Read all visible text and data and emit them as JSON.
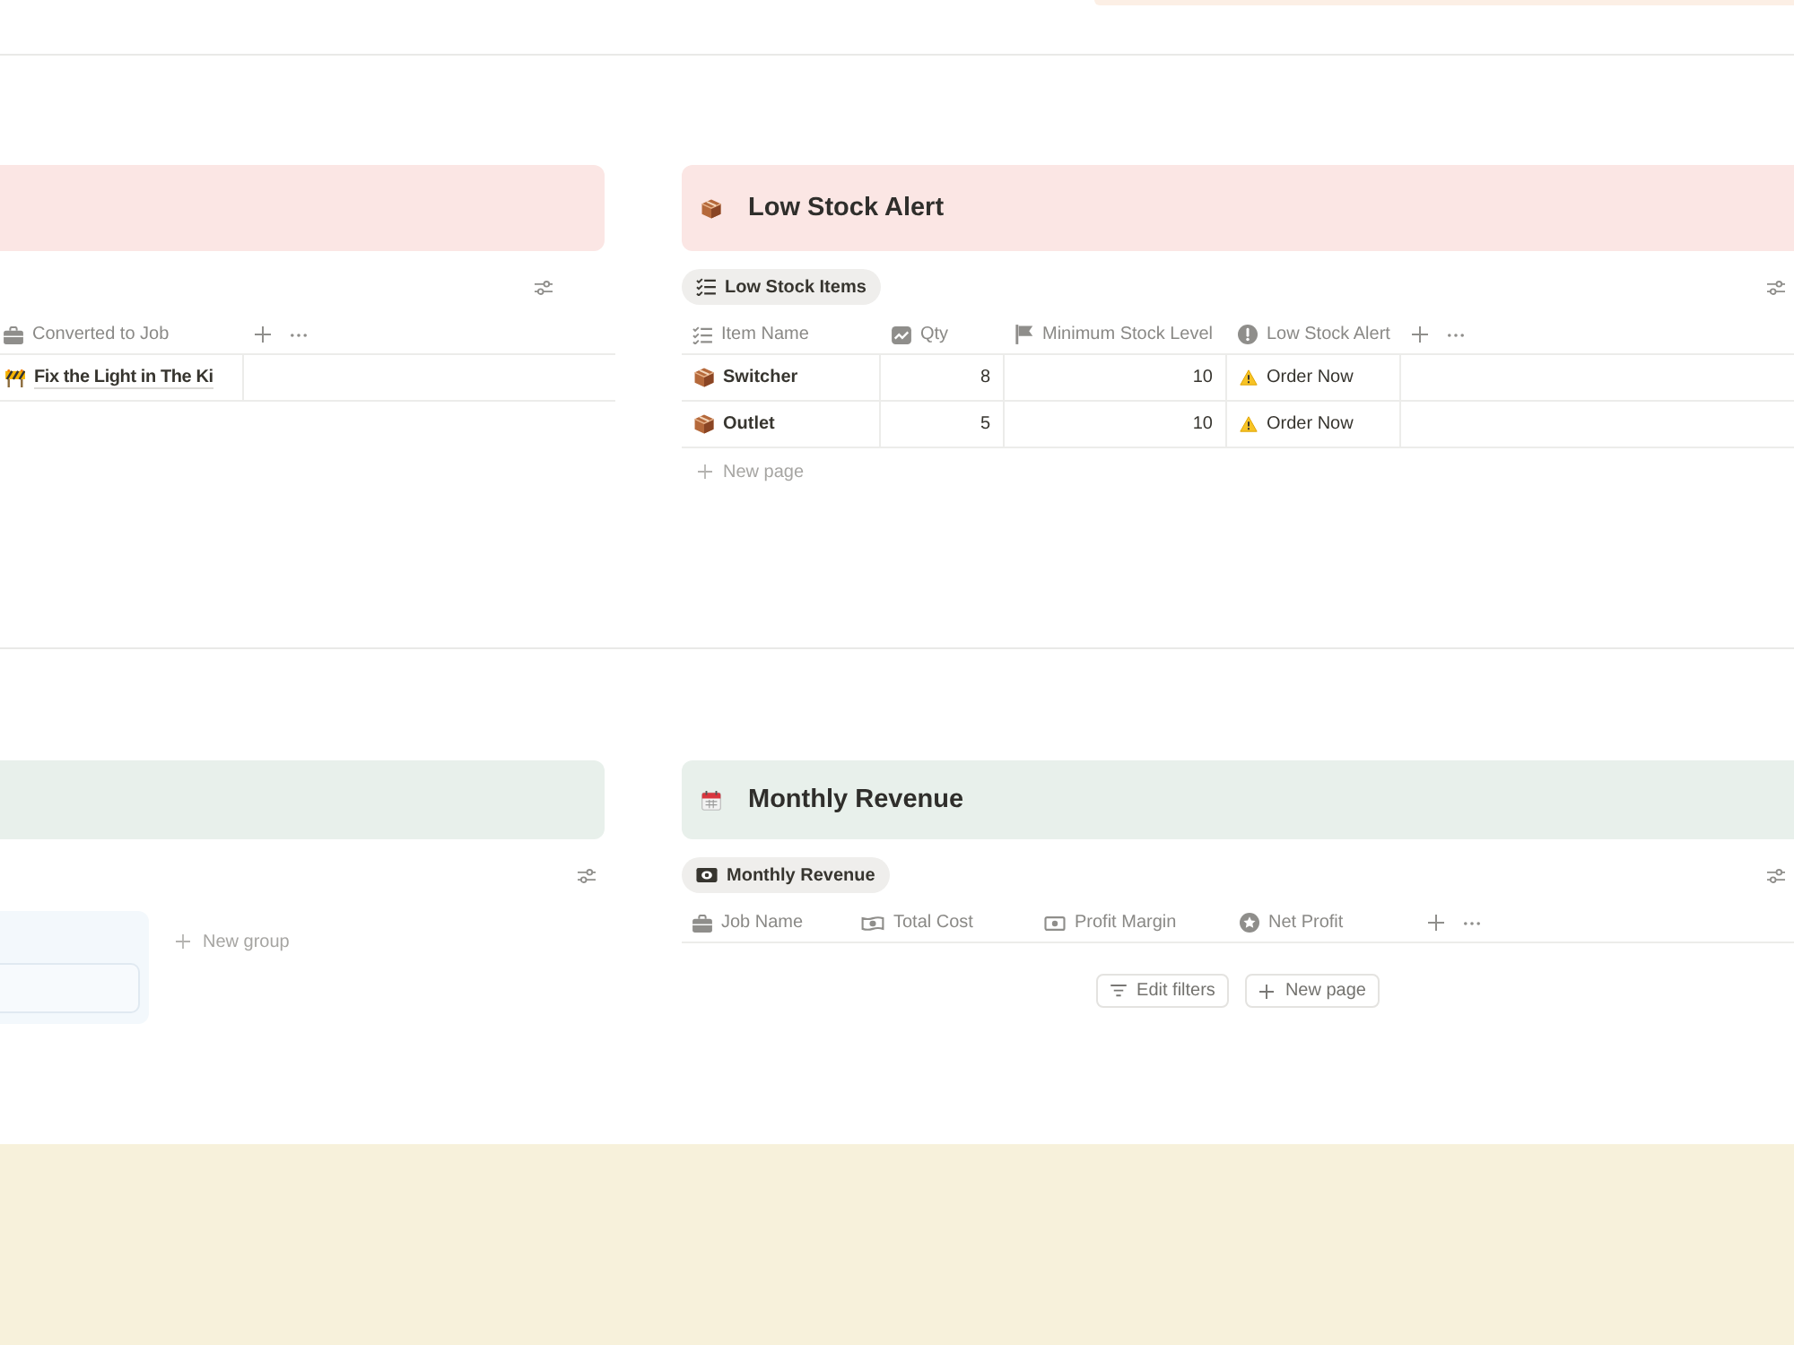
{
  "blocks": [
    {
      "kind": "callout",
      "color": "#fcefe5"
    },
    {
      "kind": "divider"
    },
    {
      "kind": "columns",
      "sections": [
        {
          "banner": {
            "color": "#fbe6e4"
          },
          "view": {
            "kind": "table",
            "columns": [
              {
                "label": "Converted to Job",
                "kind": "relation"
              }
            ],
            "rows": [
              {
                "cells": [
                  "Fix the Light in The Ki"
                ]
              }
            ]
          }
        },
        {
          "banner": {
            "color": "#fbe6e4",
            "title": "Low Stock Alert"
          },
          "view": {
            "kind": "table",
            "tabs": [
              {
                "label": "Low Stock Items",
                "selected": true
              }
            ],
            "columns": [
              {
                "label": "Item Name",
                "kind": "title"
              },
              {
                "label": "Qty",
                "kind": "number"
              },
              {
                "label": "Minimum Stock Level",
                "kind": "number"
              },
              {
                "label": "Low Stock Alert",
                "kind": "alert"
              }
            ],
            "rows": [
              {
                "cells": [
                  "Switcher",
                  "8",
                  "10",
                  "Order Now"
                ]
              },
              {
                "cells": [
                  "Outlet",
                  "5",
                  "10",
                  "Order Now"
                ]
              }
            ],
            "new_page": "New page"
          }
        }
      ]
    },
    {
      "kind": "divider"
    },
    {
      "kind": "columns",
      "sections": [
        {
          "banner": {
            "color": "#e8f0eb"
          },
          "view": {
            "kind": "board",
            "new_group": "New group"
          }
        },
        {
          "banner": {
            "color": "#e8f0eb",
            "title": "Monthly Revenue"
          },
          "view": {
            "kind": "table",
            "tabs": [
              {
                "label": "Monthly Revenue",
                "selected": true
              }
            ],
            "columns": [
              {
                "label": "Job Name"
              },
              {
                "label": "Total Cost"
              },
              {
                "label": "Profit Margin"
              },
              {
                "label": "Net Profit"
              }
            ],
            "empty_actions": [
              {
                "kind": "filter",
                "label": "Edit filters"
              },
              {
                "kind": "add",
                "label": "New page"
              }
            ]
          }
        }
      ]
    },
    {
      "kind": "callout",
      "color": "#f7f1db"
    }
  ]
}
